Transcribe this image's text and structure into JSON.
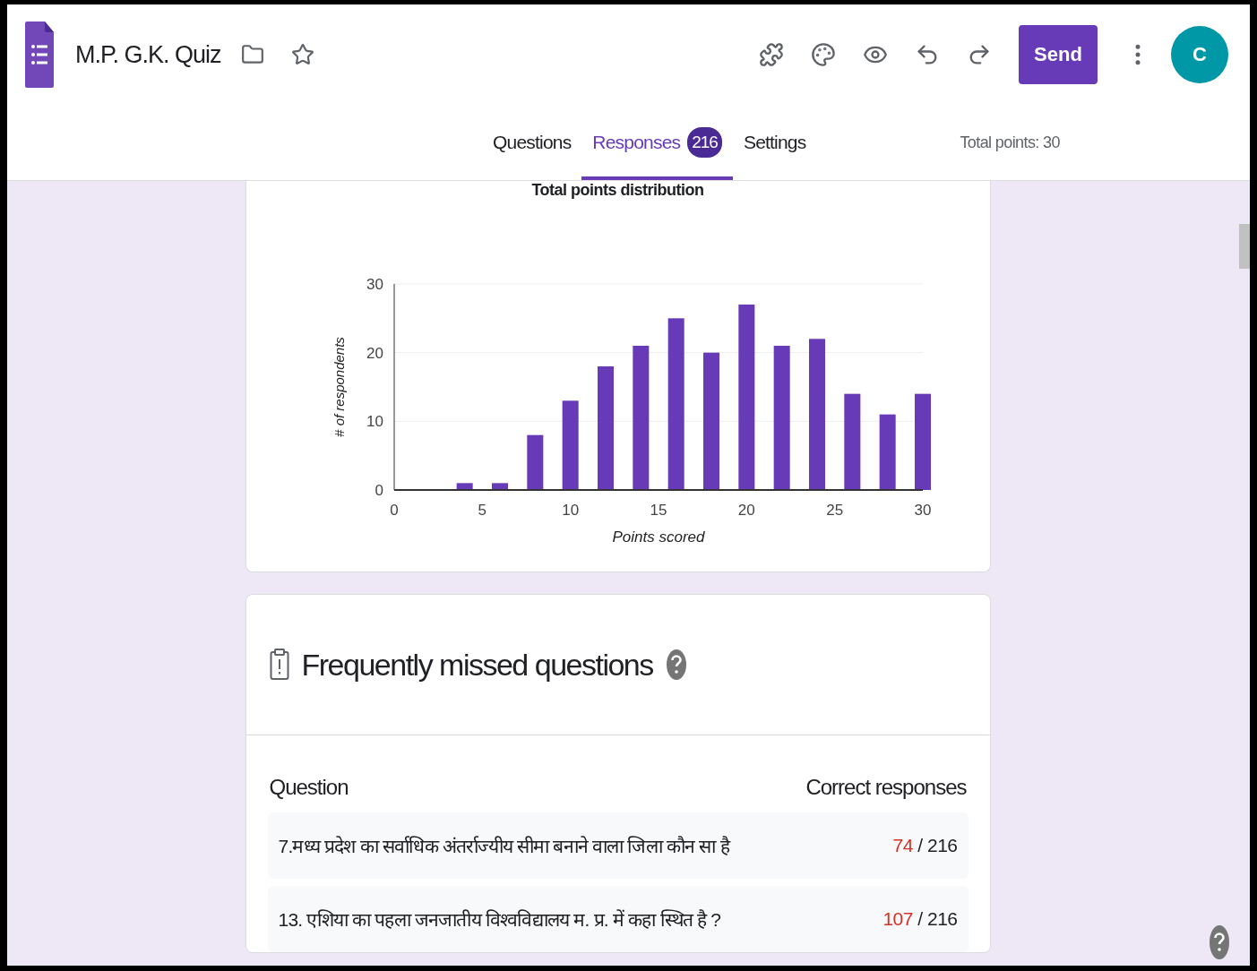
{
  "app": {
    "title": "M.P. G.K. Quiz",
    "send_label": "Send",
    "avatar_initial": "C"
  },
  "tabs": [
    {
      "label": "Questions",
      "selected": false
    },
    {
      "label": "Responses",
      "selected": true,
      "badge": "216"
    },
    {
      "label": "Settings",
      "selected": false
    }
  ],
  "total_points": "Total points: 30",
  "distribution": {
    "chart_data": {
      "type": "bar",
      "title": "Total points distribution",
      "xlabel": "Points scored",
      "ylabel": "# of respondents",
      "x": [
        4,
        6,
        8,
        10,
        12,
        14,
        16,
        18,
        20,
        22,
        24,
        26,
        28,
        30
      ],
      "values": [
        1,
        1,
        8,
        13,
        18,
        21,
        25,
        20,
        27,
        21,
        22,
        14,
        11,
        14
      ],
      "xlim": [
        0,
        30
      ],
      "ylim": [
        0,
        30
      ],
      "xticks": [
        0,
        5,
        10,
        15,
        20,
        25,
        30
      ],
      "yticks": [
        0,
        10,
        20,
        30
      ]
    }
  },
  "missed": {
    "title": "Frequently missed questions",
    "columns": [
      "Question",
      "Correct responses"
    ],
    "rows": [
      {
        "question": "7.मध्य प्रदेश का सर्वाधिक अंतर्राज्यीय सीमा बनाने वाला जिला कौन सा है",
        "correct": "74",
        "total": "/ 216"
      },
      {
        "question": "13. एशिया का पहला जनजातीय विश्वविद्यालय म. प्र. में कहा स्थित है ?",
        "correct": "107",
        "total": "/ 216"
      }
    ]
  }
}
